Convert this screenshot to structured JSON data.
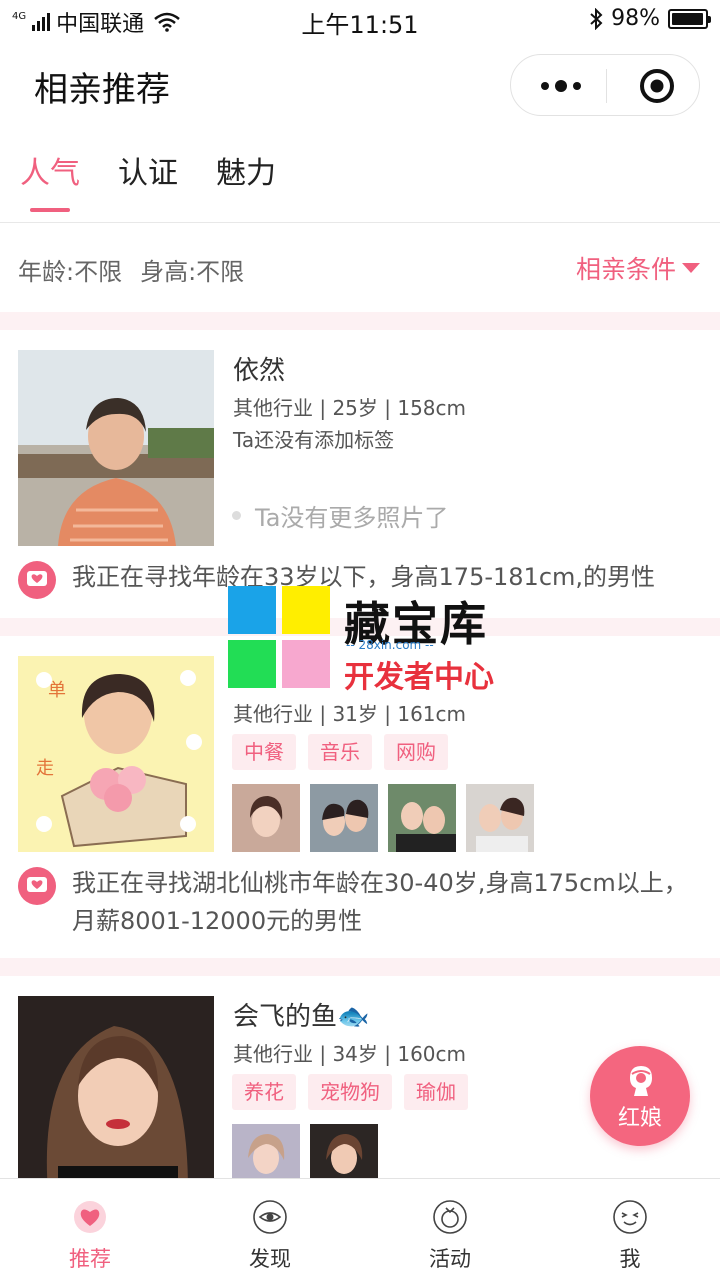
{
  "status_bar": {
    "network_type": "4G",
    "carrier": "中国联通",
    "time": "上午11:51",
    "battery": "98%",
    "battery_level": 0.98
  },
  "nav": {
    "title": "相亲推荐",
    "more_icon": "more-dots-icon",
    "close_icon": "target-icon"
  },
  "tabs": [
    {
      "label": "人气",
      "active": true
    },
    {
      "label": "认证",
      "active": false
    },
    {
      "label": "魅力",
      "active": false
    }
  ],
  "filter": {
    "age": "年龄:不限",
    "height": "身高:不限",
    "conditions_label": "相亲条件"
  },
  "cards": [
    {
      "name": "依然",
      "info": "其他行业 | 25岁 | 158cm",
      "no_tags_text": "Ta还没有添加标签",
      "no_more_photos": "Ta没有更多照片了",
      "seeking": "我正在寻找年龄在33岁以下，身高175-181cm,的男性"
    },
    {
      "name": "",
      "info": "其他行业 | 31岁 | 161cm",
      "tags": [
        "中餐",
        "音乐",
        "网购"
      ],
      "seeking": "我正在寻找湖北仙桃市年龄在30-40岁,身高175cm以上，月薪8001-12000元的男性"
    },
    {
      "name": "会飞的鱼🐟",
      "info": "其他行业 | 34岁 | 160cm",
      "tags": [
        "养花",
        "宠物狗",
        "瑜伽"
      ]
    }
  ],
  "watermark": {
    "title": "藏宝库",
    "url": "-- 28xin.com --",
    "subtitle": "开发者中心"
  },
  "floating_button": {
    "label": "红娘"
  },
  "tabbar": [
    {
      "label": "推荐",
      "icon": "heart-icon",
      "active": true
    },
    {
      "label": "发现",
      "icon": "eye-icon",
      "active": false
    },
    {
      "label": "活动",
      "icon": "activity-icon",
      "active": false
    },
    {
      "label": "我",
      "icon": "smile-icon",
      "active": false
    }
  ],
  "colors": {
    "accent": "#f0607f",
    "tag_bg": "#fdecef",
    "separator": "#fdf1f3"
  }
}
